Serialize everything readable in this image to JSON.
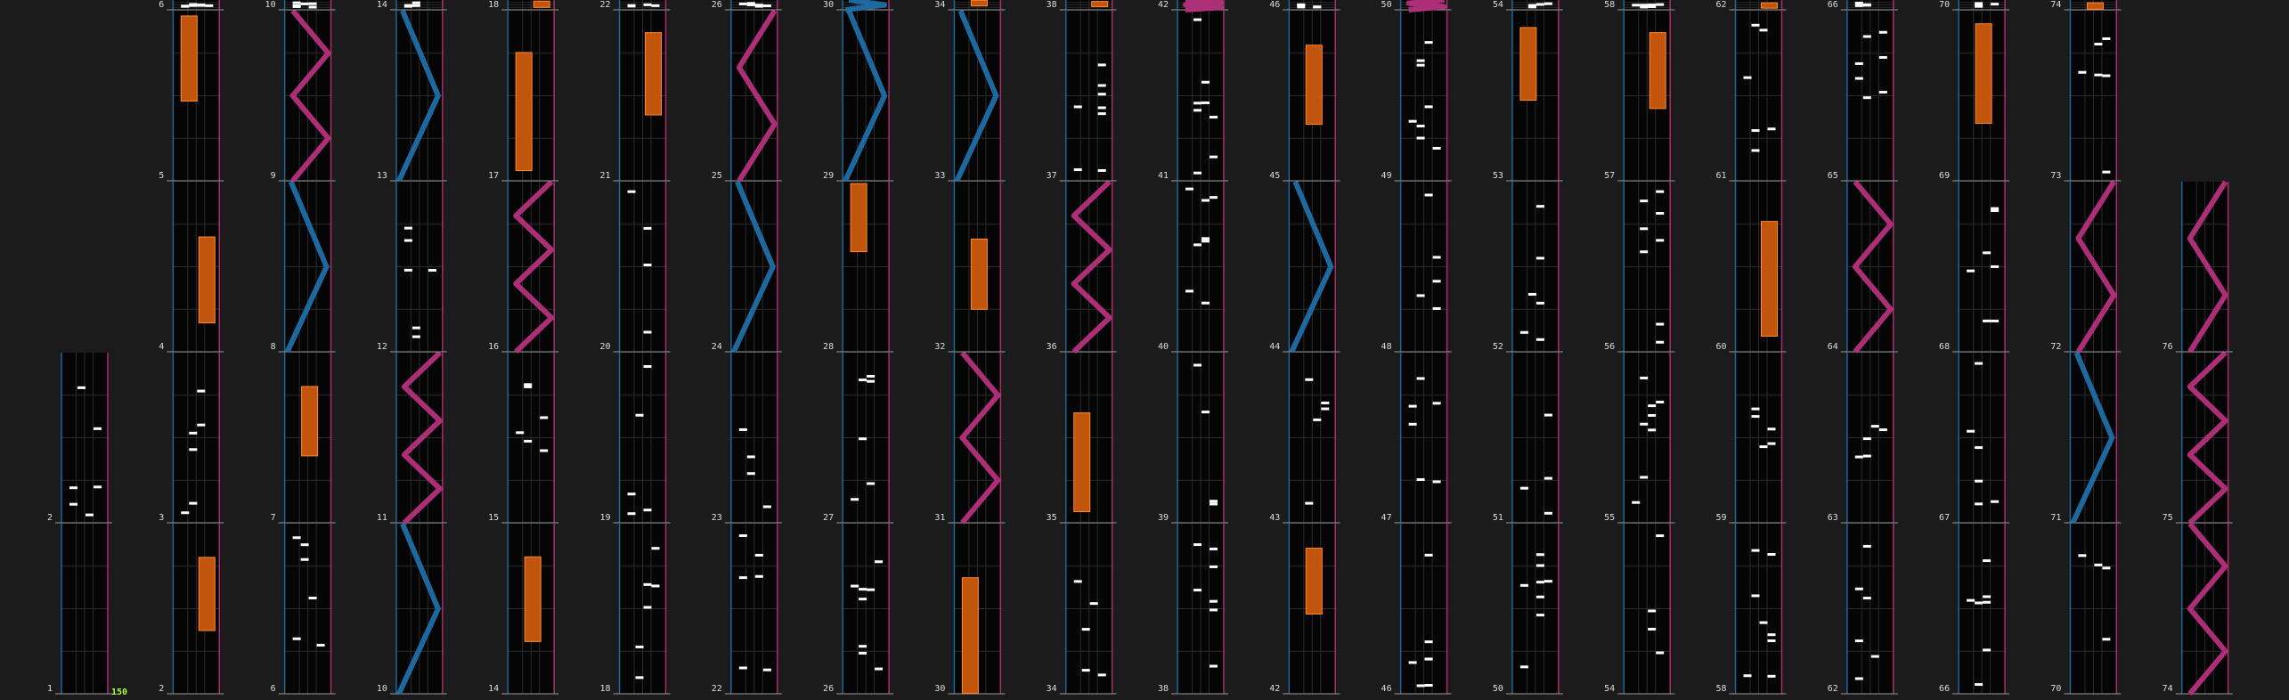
{
  "chart_view": {
    "title": "",
    "bpm_label": "150",
    "colors": {
      "background": "#1b1b1b",
      "lane_bg": "#050505",
      "grid_minor": "#2a2a2a",
      "grid_major": "#9a9a9a",
      "left_border": "#1d6b9c",
      "right_border": "#b0306f",
      "note": "#ffffff",
      "hold": "#c2550d",
      "hold_edge": "#ff8a2a",
      "laser_left": "#1f6fa8",
      "laser_right": "#b4307c",
      "bpm_text": "#a8ff3e"
    }
  },
  "measures": [
    {
      "n": 1
    },
    {
      "n": 2
    },
    {
      "n": 2
    },
    {
      "n": 3
    },
    {
      "n": 4
    },
    {
      "n": 5
    },
    {
      "n": 6
    },
    {
      "n": 6
    },
    {
      "n": 7
    },
    {
      "n": 8
    },
    {
      "n": 9
    },
    {
      "n": 10
    },
    {
      "n": 10
    },
    {
      "n": 11
    },
    {
      "n": 12
    },
    {
      "n": 13
    },
    {
      "n": 14
    },
    {
      "n": 14
    },
    {
      "n": 15
    },
    {
      "n": 16
    },
    {
      "n": 17
    },
    {
      "n": 18
    },
    {
      "n": 18
    },
    {
      "n": 19
    },
    {
      "n": 20
    },
    {
      "n": 21
    },
    {
      "n": 22
    },
    {
      "n": 22
    },
    {
      "n": 23
    },
    {
      "n": 24
    },
    {
      "n": 25
    },
    {
      "n": 26
    },
    {
      "n": 26
    },
    {
      "n": 27
    },
    {
      "n": 28
    },
    {
      "n": 29
    },
    {
      "n": 30
    },
    {
      "n": 30
    },
    {
      "n": 31
    },
    {
      "n": 32
    },
    {
      "n": 33
    },
    {
      "n": 34
    },
    {
      "n": 34
    },
    {
      "n": 35
    },
    {
      "n": 36
    },
    {
      "n": 37
    },
    {
      "n": 38
    },
    {
      "n": 38
    },
    {
      "n": 39
    },
    {
      "n": 40
    },
    {
      "n": 41
    },
    {
      "n": 42
    },
    {
      "n": 42
    },
    {
      "n": 43
    },
    {
      "n": 44
    },
    {
      "n": 45
    },
    {
      "n": 46
    },
    {
      "n": 46
    },
    {
      "n": 47
    },
    {
      "n": 48
    },
    {
      "n": 49
    },
    {
      "n": 50
    },
    {
      "n": 50
    },
    {
      "n": 51
    },
    {
      "n": 52
    },
    {
      "n": 53
    },
    {
      "n": 54
    },
    {
      "n": 54
    },
    {
      "n": 55
    },
    {
      "n": 56
    },
    {
      "n": 57
    },
    {
      "n": 58
    },
    {
      "n": 58
    },
    {
      "n": 59
    },
    {
      "n": 60
    },
    {
      "n": 61
    },
    {
      "n": 62
    },
    {
      "n": 62
    },
    {
      "n": 63
    },
    {
      "n": 64
    },
    {
      "n": 65
    },
    {
      "n": 66
    },
    {
      "n": 66
    },
    {
      "n": 67
    },
    {
      "n": 68
    },
    {
      "n": 69
    },
    {
      "n": 70
    },
    {
      "n": 70
    },
    {
      "n": 71
    },
    {
      "n": 72
    },
    {
      "n": 73
    },
    {
      "n": 74
    },
    {
      "n": 74
    },
    {
      "n": 75
    },
    {
      "n": 76
    }
  ]
}
